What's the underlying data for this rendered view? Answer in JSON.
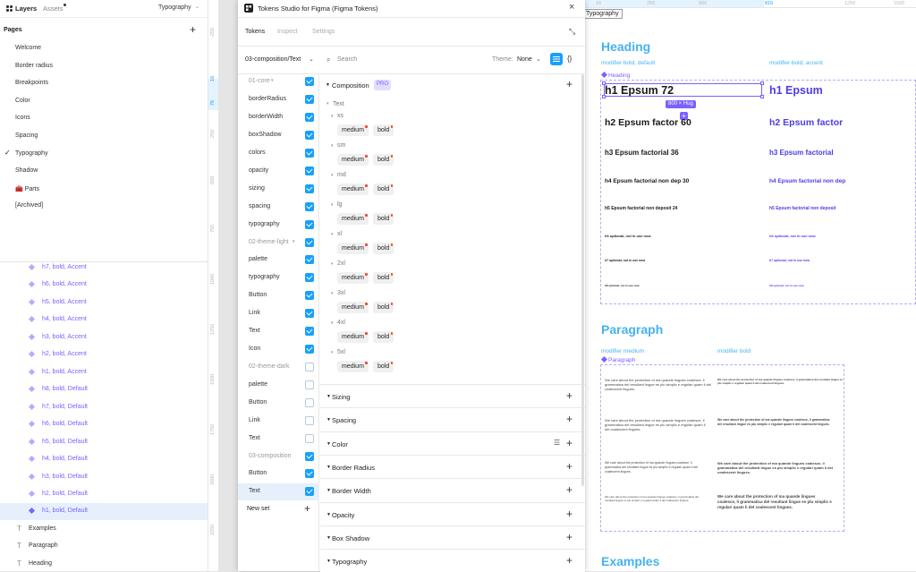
{
  "left_panel": {
    "tabs": [
      "Layers",
      "Assets"
    ],
    "page_selector": "Typography",
    "pages_title": "Pages",
    "pages": [
      "Welcome",
      "Border radius",
      "Breakpoints",
      "Color",
      "Icons",
      "Spacing",
      "Typography",
      "Shadow",
      "🧰 Parts",
      "[Archived]"
    ],
    "selected_page": "Typography",
    "layers": [
      "h7, bold, Accent",
      "h6, bold, Accent",
      "h5, bold, Accent",
      "h4, bold, Accent",
      "h3, bold, Accent",
      "h2, bold, Accent",
      "h1, bold, Accent",
      "h8, bold, Default",
      "h7, bold, Default",
      "h6, bold, Default",
      "h5, bold, Default",
      "h4, bold, Default",
      "h3, bold, Default",
      "h2, bold, Default",
      "h1, bold, Default"
    ],
    "selected_layer": "h1, bold, Default",
    "text_layers": [
      "Examples",
      "Paragraph",
      "Heading"
    ]
  },
  "vertical_ruler": [
    "-250",
    "16",
    "76",
    "250",
    "500",
    "750",
    "1000",
    "1250",
    "1500",
    "1750",
    "2000",
    "2250"
  ],
  "horizontal_ruler": [
    "16",
    "250",
    "500",
    "816",
    "1250",
    "1500"
  ],
  "plugin": {
    "title": "Tokens Studio for Figma (Figma Tokens)",
    "tabs": [
      "Tokens",
      "Inspect",
      "Settings"
    ],
    "active_tab": "Tokens",
    "token_set": "03-composition/Text",
    "search_placeholder": "Search",
    "theme_label": "Theme:",
    "theme_value": "None",
    "sets": [
      {
        "label": "01-core",
        "group": true,
        "checked": true
      },
      {
        "label": "borderRadius",
        "checked": true
      },
      {
        "label": "borderWidth",
        "checked": true
      },
      {
        "label": "boxShadow",
        "checked": true
      },
      {
        "label": "colors",
        "checked": true
      },
      {
        "label": "opacity",
        "checked": true
      },
      {
        "label": "sizing",
        "checked": true
      },
      {
        "label": "spacing",
        "checked": true
      },
      {
        "label": "typography",
        "checked": true
      },
      {
        "label": "02-theme-light",
        "group": true,
        "checked": true
      },
      {
        "label": "palette",
        "checked": true
      },
      {
        "label": "typography",
        "checked": true
      },
      {
        "label": "Button",
        "checked": true
      },
      {
        "label": "Link",
        "checked": true
      },
      {
        "label": "Text",
        "checked": true
      },
      {
        "label": "Icon",
        "checked": true
      },
      {
        "label": "02-theme-dark",
        "group": true,
        "checked": false
      },
      {
        "label": "palette",
        "checked": false
      },
      {
        "label": "Button",
        "checked": false
      },
      {
        "label": "Link",
        "checked": false
      },
      {
        "label": "Text",
        "checked": false
      },
      {
        "label": "03-composition",
        "group": true,
        "checked": true
      },
      {
        "label": "Button",
        "checked": true
      },
      {
        "label": "Text",
        "checked": true
      }
    ],
    "new_set": "New set",
    "composition": {
      "title": "Composition",
      "badge": "PRO",
      "group": "Text",
      "sizes": [
        "xs",
        "sm",
        "md",
        "lg",
        "xl",
        "2xl",
        "3xl",
        "4xl",
        "5xl"
      ],
      "tokens": [
        "medium",
        "bold"
      ]
    },
    "sections": [
      "Sizing",
      "Spacing",
      "Color",
      "Border Radius",
      "Border Width",
      "Opacity",
      "Box Shadow",
      "Typography"
    ]
  },
  "canvas": {
    "frame_label": "Typography",
    "heading_title": "Heading",
    "modifier_default": "modifier bold, default",
    "modifier_accent": "modifier bold, accent",
    "component_label": "Heading",
    "size_badge": "800 × Hug",
    "headings_default": [
      "h1 Epsum 72",
      "h2 Epsum factor 60",
      "h3 Epsum factorial 36",
      "h4 Epsum factorial non dep 30",
      "h5 Epsum factorial non deposit 24",
      "h6 optional, not in use now",
      "h7 optional, not in use now",
      "h8 optional, not in use now"
    ],
    "headings_accent": [
      "h1 Epsum",
      "h2 Epsum factor",
      "h3 Epsum factorial",
      "h4 Epsum factorial non dep",
      "h5 Epsum factorial non deposit",
      "h6 optional, not in use now",
      "h7 optional, not in use now",
      "h8 optional, not in use now"
    ],
    "paragraph_title": "Paragraph",
    "modifier_medium": "modifier medium",
    "modifier_bold": "modifier bold",
    "paragraph_component": "Paragraph",
    "paragraph_line1": "We care about the protection of ma quande lingues coalesce, li grammatica del resultant lingue es plu simplic e regulari quam li del coalescent lingues.",
    "paragraph_line2": "We care about the protection of ma quande lingues coalesce, li grammatica del resultant lingue es plu simplic e regulari quam li del coalescent lingues.",
    "examples_title": "Examples",
    "accent_color": "#4d3ce8",
    "heading_color": "#45b3f0"
  }
}
